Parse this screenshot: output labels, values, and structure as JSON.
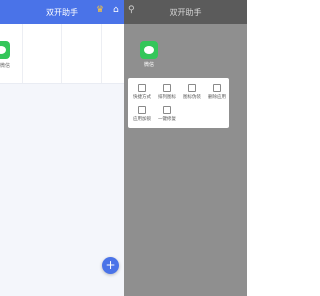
{
  "left": {
    "title": "双开助手",
    "app_label": "微信",
    "add_symbol": "+",
    "crown_symbol": "♛",
    "home_symbol": "⌂"
  },
  "right": {
    "title": "双开助手",
    "app_label": "微信",
    "person_symbol": "⚲",
    "menu": [
      {
        "label": "快捷方式",
        "icon": "shortcut-icon"
      },
      {
        "label": "排列图标",
        "icon": "arrange-icon"
      },
      {
        "label": "图标伪装",
        "icon": "disguise-icon"
      },
      {
        "label": "删除应用",
        "icon": "delete-icon"
      },
      {
        "label": "应用加锁",
        "icon": "lock-icon"
      },
      {
        "label": "一键修复",
        "icon": "repair-icon"
      }
    ]
  }
}
